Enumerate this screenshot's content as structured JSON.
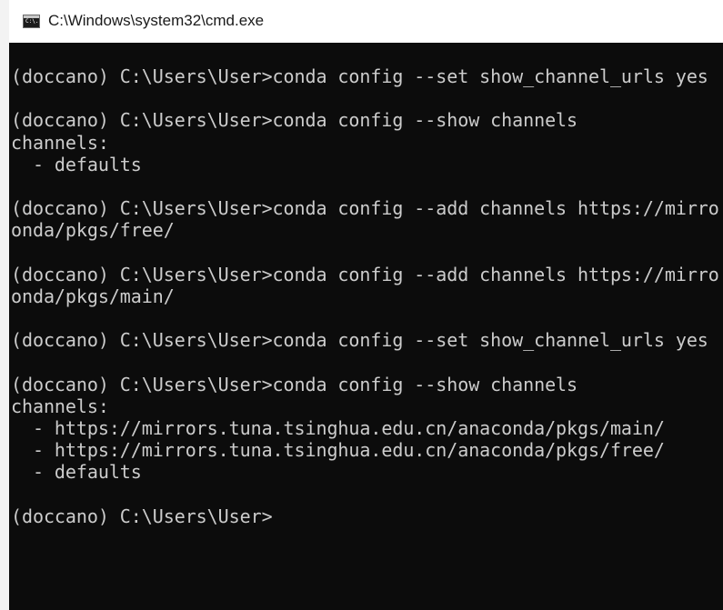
{
  "window": {
    "title": "C:\\Windows\\system32\\cmd.exe",
    "icon": "cmd-console-icon",
    "icon_text": "C:\\."
  },
  "console": {
    "background": "#0c0c0c",
    "foreground": "#cccccc",
    "lines": [
      "(doccano) C:\\Users\\User>conda config --set show_channel_urls yes",
      "",
      "(doccano) C:\\Users\\User>conda config --show channels",
      "channels:",
      "  - defaults",
      "",
      "(doccano) C:\\Users\\User>conda config --add channels https://mirro",
      "onda/pkgs/free/",
      "",
      "(doccano) C:\\Users\\User>conda config --add channels https://mirro",
      "onda/pkgs/main/",
      "",
      "(doccano) C:\\Users\\User>conda config --set show_channel_urls yes",
      "",
      "(doccano) C:\\Users\\User>conda config --show channels",
      "channels:",
      "  - https://mirrors.tuna.tsinghua.edu.cn/anaconda/pkgs/main/",
      "  - https://mirrors.tuna.tsinghua.edu.cn/anaconda/pkgs/free/",
      "  - defaults",
      "",
      "(doccano) C:\\Users\\User>"
    ]
  }
}
